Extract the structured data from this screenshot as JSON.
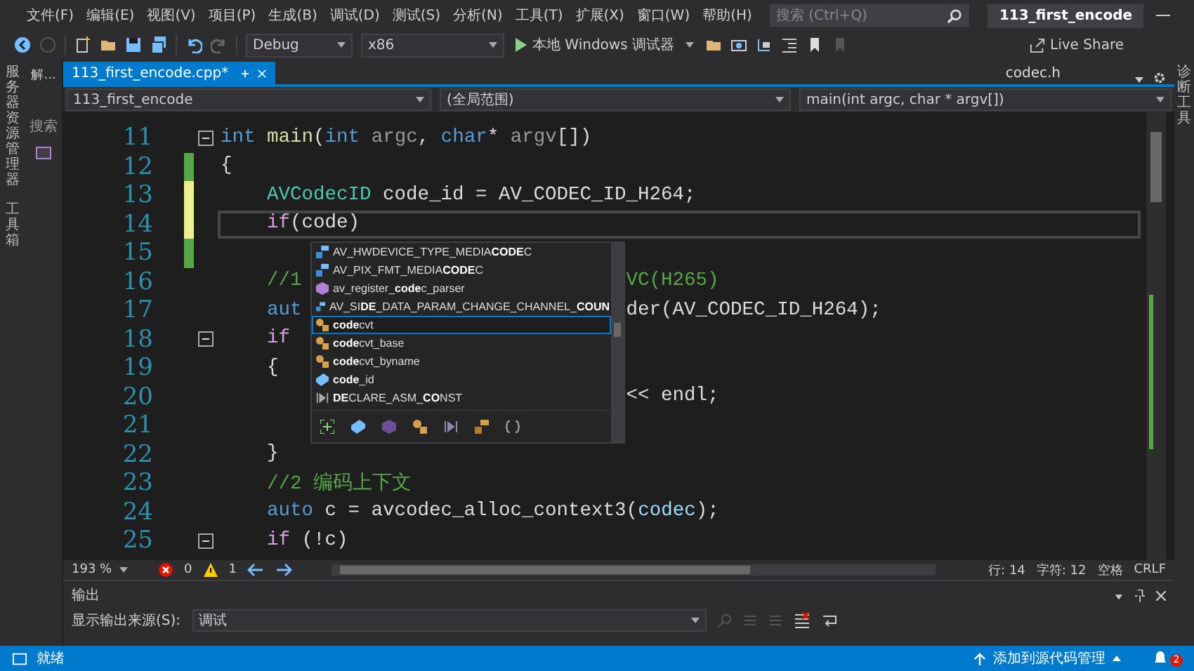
{
  "menu_bar": {
    "items": [
      "文件(F)",
      "编辑(E)",
      "视图(V)",
      "项目(P)",
      "生成(B)",
      "调试(D)",
      "测试(S)",
      "分析(N)",
      "工具(T)",
      "扩展(X)",
      "窗口(W)",
      "帮助(H)"
    ],
    "search": {
      "placeholder": "搜索 (Ctrl+Q)"
    },
    "title": "113_first_encode"
  },
  "toolbar": {
    "configuration": "Debug",
    "platform": "x86",
    "run_button": "本地 Windows 调试器",
    "live_share": "Live Share"
  },
  "side_panels": {
    "left": [
      "服务器资源管理器",
      "工具箱"
    ],
    "solution_tab": "解...",
    "search_label": "搜索",
    "right": [
      "诊断工具"
    ]
  },
  "tabs": [
    {
      "label": "113_first_encode.cpp*",
      "selected": true
    },
    {
      "label": "codec.h",
      "selected": false
    }
  ],
  "nav_bar": {
    "project": "113_first_encode",
    "scope": "(全局范围)",
    "member": "main(int argc, char * argv[])"
  },
  "editor": {
    "lines": [
      {
        "number": "11",
        "fold": true,
        "current": false,
        "tokens": [
          {
            "t": "int",
            "kind": "keyword"
          },
          {
            "t": " main",
            "kind": "function"
          },
          {
            "t": "(",
            "kind": "plain"
          },
          {
            "t": "int",
            "kind": "keyword"
          },
          {
            "t": " argc",
            "kind": "param"
          },
          {
            "t": ", ",
            "kind": "plain"
          },
          {
            "t": "char",
            "kind": "keyword"
          },
          {
            "t": "* ",
            "kind": "plain"
          },
          {
            "t": "argv",
            "kind": "param"
          },
          {
            "t": "[])",
            "kind": "plain"
          }
        ]
      },
      {
        "number": "12",
        "fold": false,
        "current": false,
        "color": "#57a64a",
        "tokens": [
          {
            "t": "{",
            "kind": "plain"
          }
        ],
        "children": [
          {
            "number": "13",
            "fold": false,
            "current": false,
            "color": "#efef91",
            "tokens": [
              {
                "t": "AVCodecID",
                "kind": "type"
              },
              {
                "t": " code_id = AV_CODEC_ID_H264;",
                "kind": "plain"
              }
            ]
          },
          {
            "number": "14",
            "fold": false,
            "current": true,
            "color": "#efef91",
            "tokens": [
              {
                "t": "if",
                "kind": "control"
              },
              {
                "t": "(code)",
                "kind": "plain"
              }
            ]
          },
          {
            "number": "15",
            "fold": false,
            "current": false,
            "color": "#57a64a"
          },
          {
            "number": "16",
            "fold": false,
            "current": false,
            "tokens": [
              {
                "t": "//1",
                "kind": "comment"
              }
            ],
            "tail": [
              {
                "t": "VC(H265)",
                "kind": "comment"
              }
            ]
          },
          {
            "number": "17",
            "fold": false,
            "current": false,
            "tokens": [
              {
                "t": "aut",
                "kind": "keyword"
              }
            ],
            "tail": [
              {
                "t": "der(AV_CODEC_ID_H264);",
                "kind": "plain"
              }
            ]
          },
          {
            "number": "18",
            "fold": true,
            "current": false,
            "tokens": [
              {
                "t": "if",
                "kind": "control"
              }
            ]
          },
          {
            "number": "19",
            "fold": false,
            "current": false,
            "tokens": [
              {
                "t": "{",
                "kind": "plain"
              }
            ]
          },
          {
            "number": "20",
            "fold": false,
            "current": false,
            "tail": [
              {
                "t": "<< endl;",
                "kind": "plain"
              }
            ]
          },
          {
            "number": "21",
            "fold": false,
            "current": false
          },
          {
            "number": "22",
            "fold": false,
            "current": false,
            "tokens": [
              {
                "t": "}",
                "kind": "plain"
              }
            ]
          },
          {
            "number": "23",
            "fold": false,
            "current": false,
            "tokens": [
              {
                "t": "//2 编码上下文",
                "kind": "comment"
              }
            ]
          },
          {
            "number": "24",
            "fold": false,
            "current": false,
            "tokens": [
              {
                "t": "auto",
                "kind": "keyword"
              },
              {
                "t": " c = avcodec_alloc_context3(",
                "kind": "plain"
              },
              {
                "t": "codec",
                "kind": "local"
              },
              {
                "t": ");",
                "kind": "plain"
              }
            ]
          },
          {
            "number": "25",
            "fold": true,
            "current": false,
            "tokens": [
              {
                "t": "if",
                "kind": "control"
              },
              {
                "t": " (!c)",
                "kind": "plain"
              }
            ]
          }
        ]
      }
    ],
    "completion": {
      "items": [
        {
          "label": "AV_HWDEVICE_TYPE_MEDIA**CODE**C",
          "kind": "enum",
          "selected": false
        },
        {
          "label": "AV_PIX_FMT_MEDIA**CODE**C",
          "kind": "enum",
          "selected": false
        },
        {
          "label": "av_register_**code**c_parser",
          "kind": "function",
          "selected": false
        },
        {
          "label": "AV_SI**DE**_DATA_PARAM_CHANGE_CHANNEL_**COUN**",
          "kind": "enum",
          "selected": false
        },
        {
          "label": "**code**cvt",
          "kind": "class",
          "selected": true
        },
        {
          "label": "**code**cvt_base",
          "kind": "class",
          "selected": false
        },
        {
          "label": "**code**cvt_byname",
          "kind": "class",
          "selected": false
        },
        {
          "label": "**code**_id",
          "kind": "variable",
          "selected": false
        },
        {
          "label": "**DE**CLARE_ASM_**CO**NST",
          "kind": "macro",
          "selected": false
        }
      ]
    }
  },
  "editor_status": {
    "zoom": "193 %",
    "errors": "0",
    "warnings": "1",
    "line": "行: 14",
    "column": "字符: 12",
    "indent": "空格",
    "line_ending": "CRLF"
  },
  "output_panel": {
    "title": "输出",
    "source_label": "显示输出来源(S):",
    "source": "调试"
  },
  "status_bar": {
    "text": "就绪",
    "source_control": "添加到源代码管理",
    "notifications": "2"
  }
}
